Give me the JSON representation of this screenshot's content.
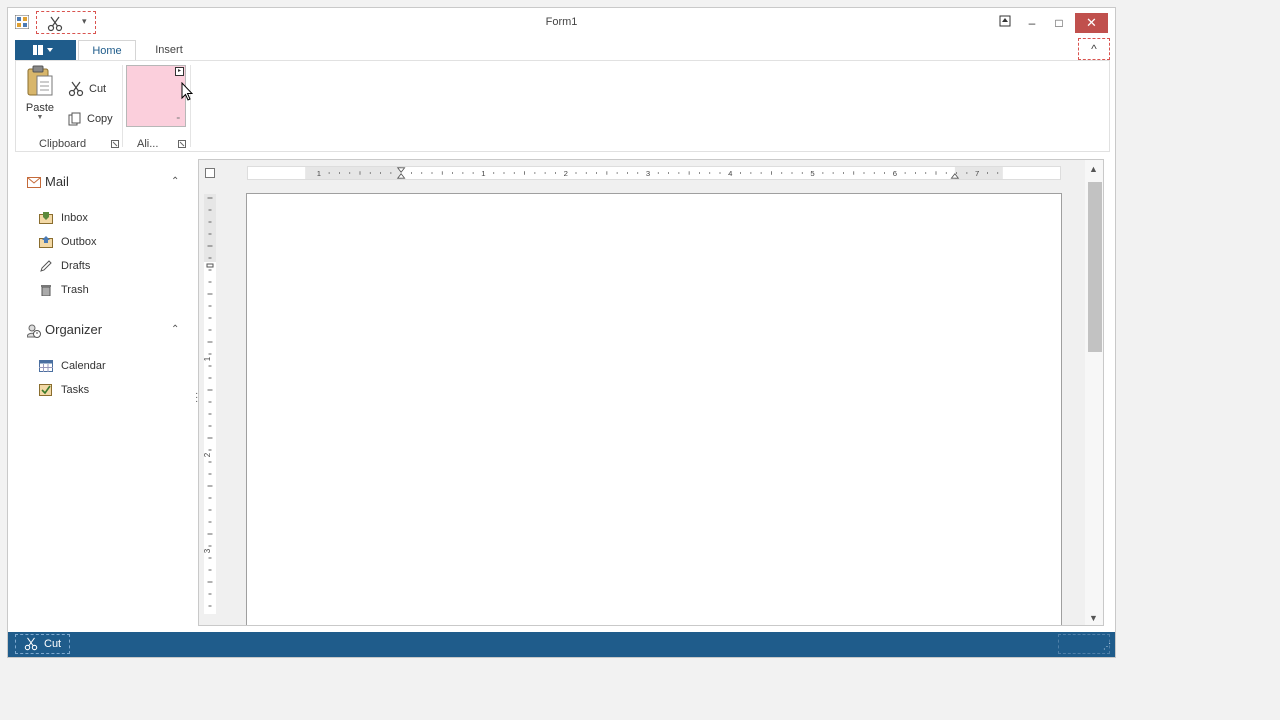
{
  "window": {
    "title": "Form1",
    "controls": {
      "restore_icon": "pin-icon",
      "minimize": "–",
      "maximize": "□",
      "close": "✕"
    }
  },
  "qat": {
    "cut_icon": "scissors-icon",
    "dropdown": "▾"
  },
  "ribbon": {
    "file_tab_icon": "app-menu-icon",
    "tabs": [
      {
        "label": "Home",
        "active": true
      },
      {
        "label": "Insert",
        "active": false
      }
    ],
    "collapse": "^",
    "groups": {
      "clipboard": {
        "label": "Clipboard",
        "paste": "Paste",
        "cut": "Cut",
        "copy": "Copy"
      },
      "align": {
        "label": "Ali...",
        "swatch_color": "#fbcfdc"
      }
    }
  },
  "nav": {
    "groups": [
      {
        "label": "Mail",
        "items": [
          "Inbox",
          "Outbox",
          "Drafts",
          "Trash"
        ]
      },
      {
        "label": "Organizer",
        "items": [
          "Calendar",
          "Tasks"
        ]
      }
    ],
    "chevron": "⌃"
  },
  "ruler": {
    "h_labels": [
      "1",
      "1",
      "2",
      "3",
      "4",
      "5",
      "6",
      "7"
    ],
    "v_labels": [
      "1",
      "2",
      "3"
    ]
  },
  "statusbar": {
    "item_label": "Cut",
    "item_icon": "scissors-icon"
  },
  "colors": {
    "accent": "#1f5c8b",
    "close": "#c0504d",
    "swatch": "#fbcfdc"
  }
}
